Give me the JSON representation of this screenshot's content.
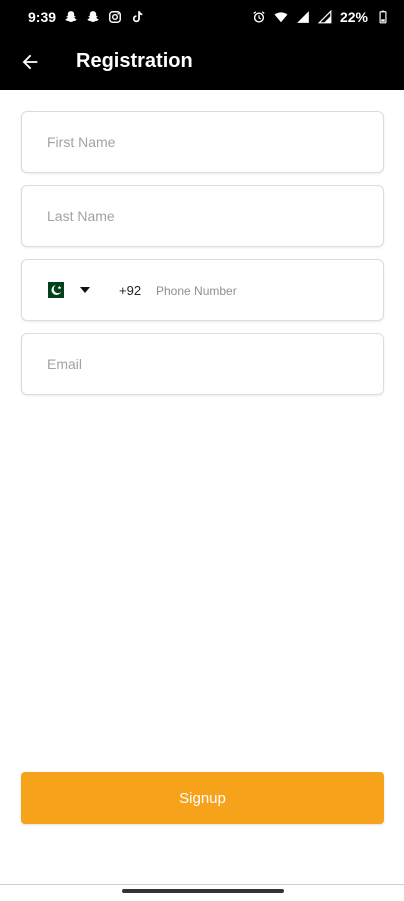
{
  "status_bar": {
    "time": "9:39",
    "battery": "22%",
    "left_icons": [
      "snapchat-icon",
      "snapchat-icon",
      "instagram-icon",
      "tiktok-icon"
    ],
    "right_icons": [
      "alarm-icon",
      "wifi-icon",
      "signal-icon",
      "signal-icon",
      "battery-icon"
    ]
  },
  "app_bar": {
    "title": "Registration",
    "back_icon": "arrow-left-icon"
  },
  "form": {
    "first_name_placeholder": "First Name",
    "last_name_placeholder": "Last Name",
    "phone": {
      "country_flag": "pakistan-flag-icon",
      "country_code": "+92",
      "placeholder": "Phone Number"
    },
    "email_placeholder": "Email"
  },
  "signup_label": "Signup",
  "colors": {
    "header": "#000000",
    "accent": "#F7A21B",
    "flag_green": "#01411C"
  }
}
